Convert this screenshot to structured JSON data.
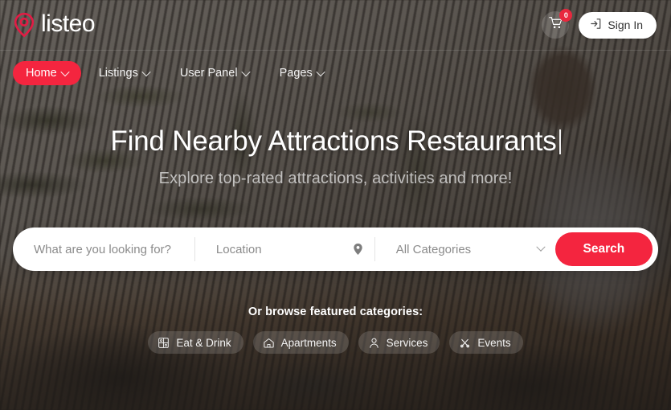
{
  "header": {
    "logo_text": "listeo",
    "logo_icon": "map-pin-icon",
    "cart_icon": "shopping-cart-icon",
    "cart_badge_count": "0",
    "signin_label": "Sign In",
    "signin_icon": "login-icon"
  },
  "nav": {
    "items": [
      {
        "label": "Home",
        "active": true,
        "caret": "chevron-down-icon"
      },
      {
        "label": "Listings",
        "active": false,
        "caret": "chevron-down-icon"
      },
      {
        "label": "User Panel",
        "active": false,
        "caret": "chevron-down-icon"
      },
      {
        "label": "Pages",
        "active": false,
        "caret": "chevron-down-icon"
      }
    ]
  },
  "hero": {
    "title": "Find Nearby Attractions Restaurants",
    "subtitle": "Explore top-rated attractions, activities and more!"
  },
  "search": {
    "keyword_placeholder": "What are you looking for?",
    "keyword_value": "",
    "location_placeholder": "Location",
    "location_value": "",
    "location_icon": "map-pin-icon",
    "category_selected": "All Categories",
    "category_caret": "chevron-down-icon",
    "submit_label": "Search"
  },
  "featured": {
    "label": "Or browse featured categories:",
    "chips": [
      {
        "label": "Eat & Drink",
        "icon": "cutlery-grid-icon"
      },
      {
        "label": "Apartments",
        "icon": "house-icon"
      },
      {
        "label": "Services",
        "icon": "person-icon"
      },
      {
        "label": "Events",
        "icon": "microphone-cross-icon"
      }
    ]
  },
  "theme": {
    "accent": "#f4253f",
    "badge": "#e8283e",
    "text_light": "#ffffff",
    "overlay": "rgba(38,34,31,0.62)"
  }
}
